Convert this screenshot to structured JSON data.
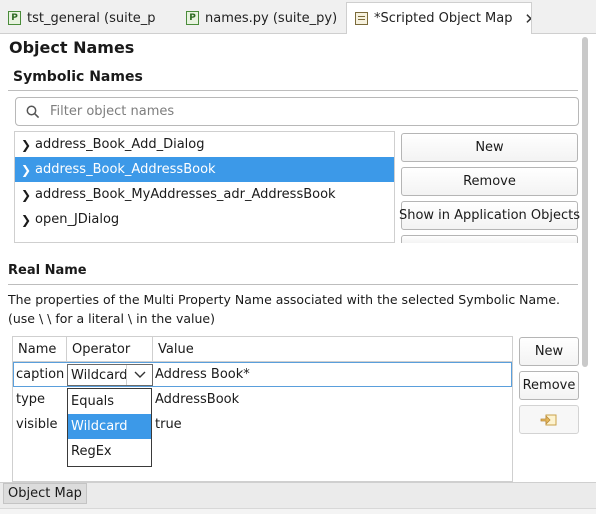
{
  "tabs": [
    {
      "label": "tst_general (suite_p",
      "icon": "python-file-icon"
    },
    {
      "label": "names.py (suite_py)",
      "icon": "python-file-icon"
    },
    {
      "label": "*Scripted Object Map",
      "icon": "object-map-icon",
      "active": true
    }
  ],
  "object_names": {
    "title": "Object Names",
    "symbolic_title": "Symbolic Names",
    "filter_placeholder": "Filter object names",
    "items": [
      {
        "label": "address_Book_Add_Dialog"
      },
      {
        "label": "address_Book_AddressBook",
        "selected": true
      },
      {
        "label": "address_Book_MyAddresses_adr_AddressBook"
      },
      {
        "label": "open_JDialog"
      }
    ],
    "buttons": {
      "new": "New",
      "remove": "Remove",
      "show_in_app": "Show in Application Objects"
    }
  },
  "real_name": {
    "title": "Real Name",
    "description": "The properties of the Multi Property Name associated with the selected Symbolic Name. (use \\ \\ for a literal \\ in the value)",
    "columns": {
      "name": "Name",
      "operator": "Operator",
      "value": "Value"
    },
    "rows": [
      {
        "name": "caption",
        "operator": "Wildcard",
        "value": "Address Book*"
      },
      {
        "name": "type",
        "operator": "",
        "value": "AddressBook"
      },
      {
        "name": "visible",
        "operator": "",
        "value": "true"
      }
    ],
    "operator_options": [
      "Equals",
      "Wildcard",
      "RegEx"
    ],
    "selected_operator": "Wildcard",
    "buttons": {
      "new": "New",
      "remove": "Remove"
    }
  },
  "bottom_tab": "Object Map",
  "colors": {
    "selection": "#3c99e8",
    "accent_border": "#5a9fdc"
  }
}
